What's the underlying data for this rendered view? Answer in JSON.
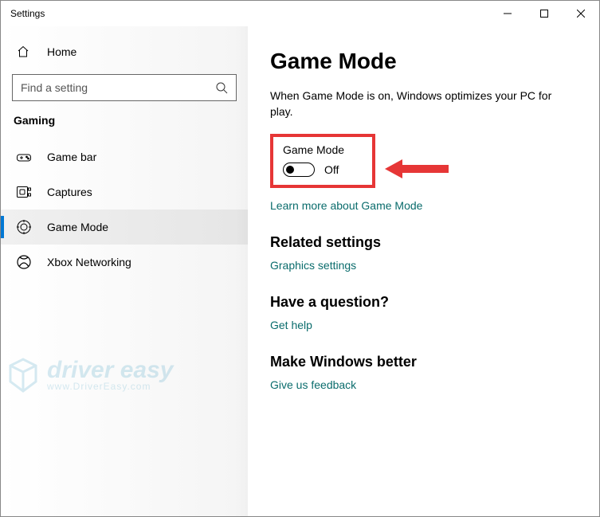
{
  "window": {
    "title": "Settings"
  },
  "sidebar": {
    "home": "Home",
    "search_placeholder": "Find a setting",
    "section": "Gaming",
    "items": [
      {
        "label": "Game bar"
      },
      {
        "label": "Captures"
      },
      {
        "label": "Game Mode"
      },
      {
        "label": "Xbox Networking"
      }
    ]
  },
  "page": {
    "title": "Game Mode",
    "description": "When Game Mode is on, Windows optimizes your PC for play.",
    "toggle_label": "Game Mode",
    "toggle_state": "Off",
    "learn_more": "Learn more about Game Mode",
    "related_heading": "Related settings",
    "related_link": "Graphics settings",
    "question_heading": "Have a question?",
    "question_link": "Get help",
    "feedback_heading": "Make Windows better",
    "feedback_link": "Give us feedback"
  },
  "watermark": {
    "line1": "driver easy",
    "line2": "www.DriverEasy.com"
  }
}
